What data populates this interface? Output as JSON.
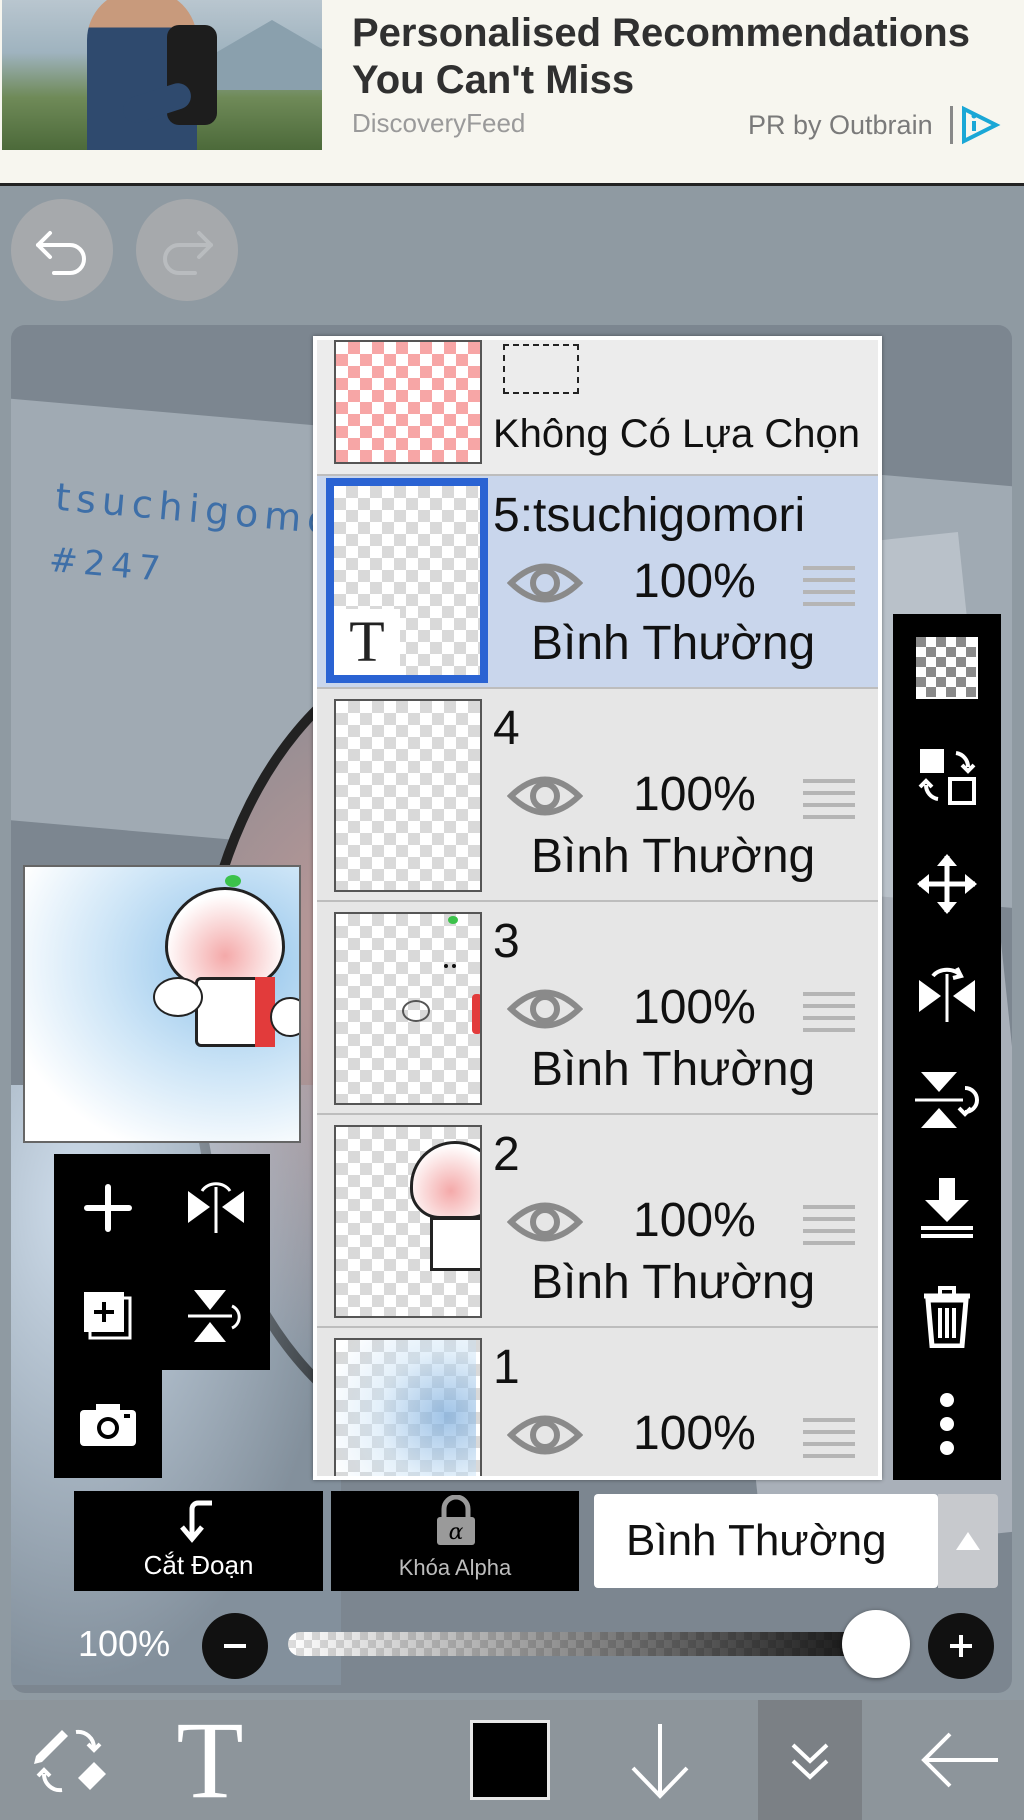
{
  "ad": {
    "title": "Personalised Recommendations You Can't Miss",
    "source": "DiscoveryFeed",
    "sponsor": "PR by Outbrain"
  },
  "canvas": {
    "watermark_line1": "tsuchigomo",
    "watermark_line2": "#247"
  },
  "layers": {
    "selection_label": "Không Có Lựa Chọn",
    "items": [
      {
        "name": "5:tsuchigomori",
        "opacity": "100%",
        "blend": "Bình Thường",
        "selected": true
      },
      {
        "name": "4",
        "opacity": "100%",
        "blend": "Bình Thường",
        "selected": false
      },
      {
        "name": "3",
        "opacity": "100%",
        "blend": "Bình Thường",
        "selected": false
      },
      {
        "name": "2",
        "opacity": "100%",
        "blend": "Bình Thường",
        "selected": false
      },
      {
        "name": "1",
        "opacity": "100%",
        "blend": "",
        "selected": false
      }
    ]
  },
  "options": {
    "clip_label": "Cắt Đoạn",
    "alpha_lock_label": "Khóa Alpha",
    "blend_mode": "Bình Thường"
  },
  "opacity": {
    "label": "100%",
    "value": 1.0
  },
  "toolbar": {
    "color": "#000000"
  },
  "icons": {
    "undo": "undo-icon",
    "redo": "redo-icon",
    "right_tools": [
      "transparency-icon",
      "layer-swap-icon",
      "move-icon",
      "flip-horizontal-icon",
      "flip-vertical-icon",
      "merge-down-icon",
      "trash-icon",
      "more-icon"
    ],
    "left_tools": [
      "add-layer-icon",
      "flip-layer-icon",
      "add-copy-layer-icon",
      "flip-vertical-layer-icon",
      "camera-icon"
    ]
  },
  "colors": {
    "selected_layer_bg": "#c9d6ec",
    "selected_border": "#2a63d3",
    "ad_choices": "#1aa7d6"
  }
}
